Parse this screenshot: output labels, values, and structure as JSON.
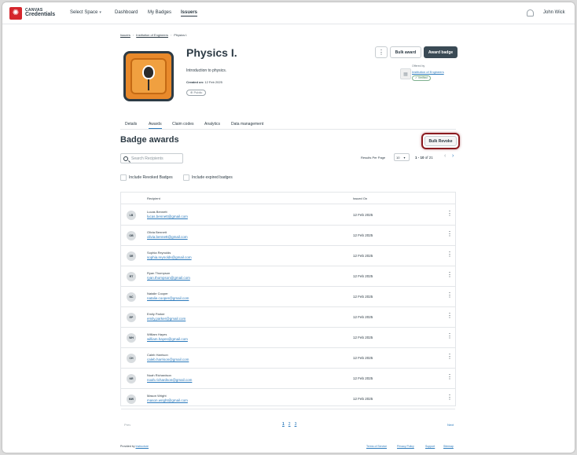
{
  "brand": {
    "line1": "CANVAS",
    "line2": "Credentials"
  },
  "nav": {
    "select_space": "Select Space",
    "dashboard": "Dashboard",
    "my_badges": "My Badges",
    "issuers": "Issuers"
  },
  "user": {
    "name": "John Wick"
  },
  "breadcrumb": [
    "Issuers",
    "Institution of Engineers",
    "Physics I."
  ],
  "badge": {
    "title": "Physics I.",
    "description": "Introduction to physics.",
    "created_label": "Created on:",
    "created_date": "12 Feb 2025",
    "visibility": "Public"
  },
  "actions": {
    "more": "⋮",
    "bulk_award": "Bulk award",
    "award_badge": "Award badge"
  },
  "issuer": {
    "offered_by": "Offered by",
    "name": "Institution of Engineers",
    "verified": "Verified"
  },
  "tabs": [
    "Details",
    "Awards",
    "Claim codes",
    "Analytics",
    "Data management"
  ],
  "section": {
    "title": "Badge awards",
    "bulk_revoke": "Bulk Revoke"
  },
  "search": {
    "placeholder": "Search Recipients"
  },
  "pagination": {
    "rpp_label": "Results Per Page",
    "rpp_value": "10",
    "range": "1 - 10",
    "of": "of 21",
    "prev": "Prev",
    "next": "Next",
    "pages": [
      "1",
      "2",
      "3"
    ]
  },
  "filters": {
    "revoked": "Include Revoked Badges",
    "expired": "Include expired badges"
  },
  "table": {
    "headers": {
      "recipient": "Recipient",
      "issued_on": "Issued On"
    },
    "rows": [
      {
        "initials": "LB",
        "name": "Lucas Bennett",
        "email": "lucas.bennett@gmail.com",
        "date": "12 Feb 2025"
      },
      {
        "initials": "OB",
        "name": "Olivia Bennett",
        "email": "olivia.bennett@gmail.com",
        "date": "12 Feb 2025"
      },
      {
        "initials": "SR",
        "name": "Sophia Reynolds",
        "email": "sophia.reynolds@gmail.com",
        "date": "12 Feb 2025"
      },
      {
        "initials": "RT",
        "name": "Ryan Thompson",
        "email": "ryan.thompson@gmail.com",
        "date": "12 Feb 2025"
      },
      {
        "initials": "NC",
        "name": "Natalie Cooper",
        "email": "natalie.cooper@gmail.com",
        "date": "12 Feb 2025"
      },
      {
        "initials": "EP",
        "name": "Emily Parker",
        "email": "emily.parker@gmail.com",
        "date": "12 Feb 2025"
      },
      {
        "initials": "WH",
        "name": "William Hayes",
        "email": "william.hayes@gmail.com",
        "date": "12 Feb 2025"
      },
      {
        "initials": "CH",
        "name": "Caleb Harrison",
        "email": "caleb.harrison@gmail.com",
        "date": "12 Feb 2025"
      },
      {
        "initials": "NR",
        "name": "Noah Richardson",
        "email": "noah.richardson@gmail.com",
        "date": "12 Feb 2025"
      },
      {
        "initials": "MW",
        "name": "Mason Wright",
        "email": "mason.wright@gmail.com",
        "date": "12 Feb 2025"
      }
    ]
  },
  "footer": {
    "provided_by": "Provided by",
    "provider": "Instructure",
    "terms": "Terms of Service",
    "privacy": "Privacy Policy",
    "support": "Support",
    "sitemap": "Sitemap"
  },
  "colors": {
    "brand_red": "#d5262c",
    "link_blue": "#2b7abc",
    "dark_button": "#3a4a55",
    "highlight": "#8b1a1f"
  }
}
